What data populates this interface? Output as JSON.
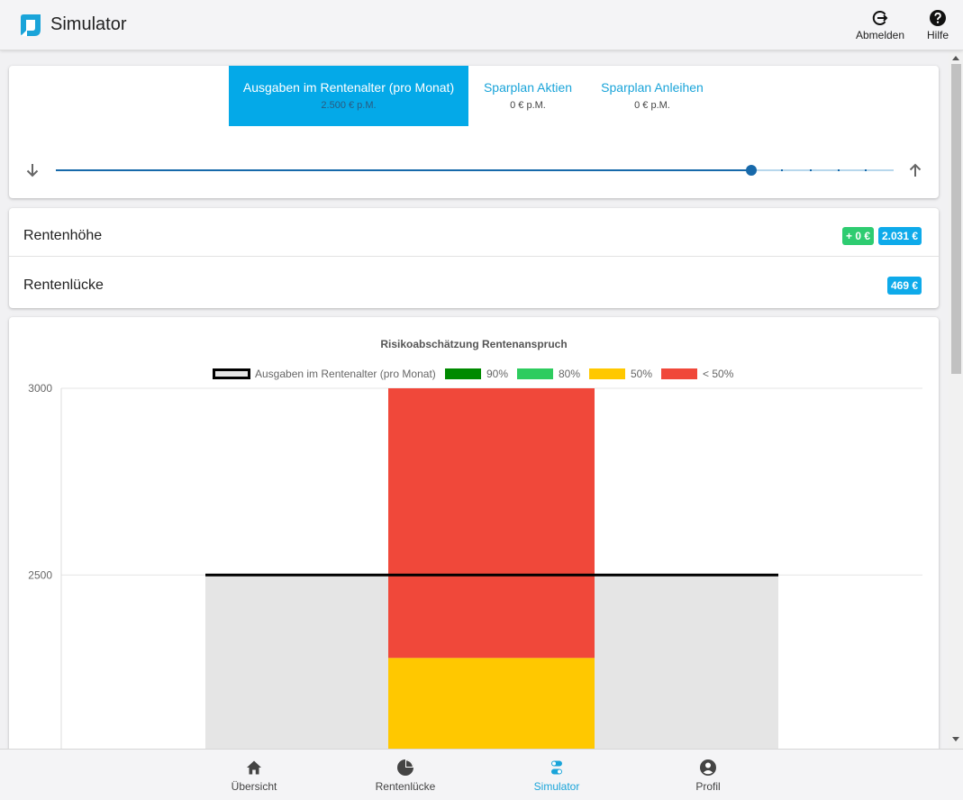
{
  "header": {
    "title": "Simulator",
    "logout_label": "Abmelden",
    "help_label": "Hilfe",
    "brand_color": "#04a9e8"
  },
  "tabs": [
    {
      "label": "Ausgaben im Rentenalter (pro Monat)",
      "value": "2.500 € p.M.",
      "active": true
    },
    {
      "label": "Sparplan Aktien",
      "value": "0 € p.M.",
      "active": false
    },
    {
      "label": "Sparplan Anleihen",
      "value": "0 € p.M.",
      "active": false
    }
  ],
  "slider": {
    "level": 0.83,
    "tick_positions": [
      0.866,
      0.9,
      0.933,
      0.966
    ]
  },
  "values": {
    "rentenhoehe_label": "Rentenhöhe",
    "rentenhoehe_delta": "+ 0 €",
    "rentenhoehe_value": "2.031 €",
    "rentenluecke_label": "Rentenlücke",
    "rentenluecke_value": "469 €"
  },
  "chart_data": {
    "type": "bar",
    "title": "Risikoabschätzung Rentenanspruch",
    "legend": [
      {
        "label": "Ausgaben im Rentenalter (pro Monat)",
        "color": "#e5e5e5",
        "border": "#000000"
      },
      {
        "label": "90%",
        "color": "#008a00"
      },
      {
        "label": "80%",
        "color": "#2ecc5f"
      },
      {
        "label": "50%",
        "color": "#ffc800"
      },
      {
        "label": "< 50%",
        "color": "#f0483a"
      }
    ],
    "yticks": [
      3000,
      2500
    ],
    "ylim_visible": [
      2035,
      3000
    ],
    "expenses_value": 2500,
    "bar_segments": [
      {
        "label": "50%",
        "from": 2035,
        "to": 2278,
        "color": "#ffc800"
      },
      {
        "label": "< 50%",
        "from": 2278,
        "to": 3000,
        "color": "#f0483a"
      }
    ],
    "legend_position": "top",
    "grid": true
  },
  "nav": {
    "items": [
      {
        "label": "Übersicht",
        "icon": "home-icon",
        "active": false
      },
      {
        "label": "Rentenlücke",
        "icon": "pie-chart-icon",
        "active": false
      },
      {
        "label": "Simulator",
        "icon": "toggle-icon",
        "active": true
      },
      {
        "label": "Profil",
        "icon": "account-icon",
        "active": false
      }
    ],
    "active_color": "#1aa4d9"
  }
}
